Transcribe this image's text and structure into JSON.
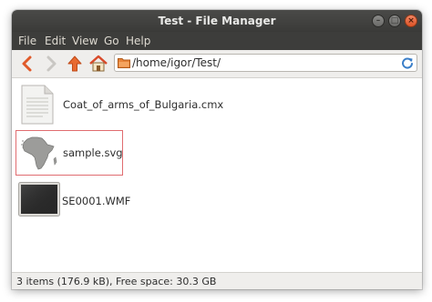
{
  "window": {
    "title": "Test - File Manager",
    "minimize_glyph": "–",
    "maximize_glyph": "□",
    "close_glyph": "×"
  },
  "menu": [
    {
      "label": "File"
    },
    {
      "label": "Edit"
    },
    {
      "label": "View"
    },
    {
      "label": "Go"
    },
    {
      "label": "Help"
    }
  ],
  "toolbar": {
    "buttons": [
      {
        "name": "back-icon",
        "color": "#e05a2a"
      },
      {
        "name": "forward-icon",
        "color": "#c9c7c3"
      },
      {
        "name": "up-icon",
        "color": "#e86a30"
      },
      {
        "name": "home-icon",
        "color": "#d94a2a"
      }
    ],
    "location": {
      "path": "/home/igor/Test/",
      "folder_icon": "folder-icon",
      "reload_icon": "reload-icon"
    }
  },
  "files": [
    {
      "name": "Coat_of_arms_of_Bulgaria.cmx",
      "icon": "document-icon",
      "selected": false
    },
    {
      "name": "sample.svg",
      "icon": "africa-map-thumbnail-icon",
      "selected": true
    },
    {
      "name": "SE0001.WMF",
      "icon": "dark-image-thumbnail-icon",
      "selected": false
    }
  ],
  "status": {
    "text": "3 items (176.9 kB), Free space: 30.3 GB"
  },
  "colors": {
    "titlebar": "#3d3d3b",
    "selection_border": "#e06c70",
    "close_button": "#df5427"
  }
}
